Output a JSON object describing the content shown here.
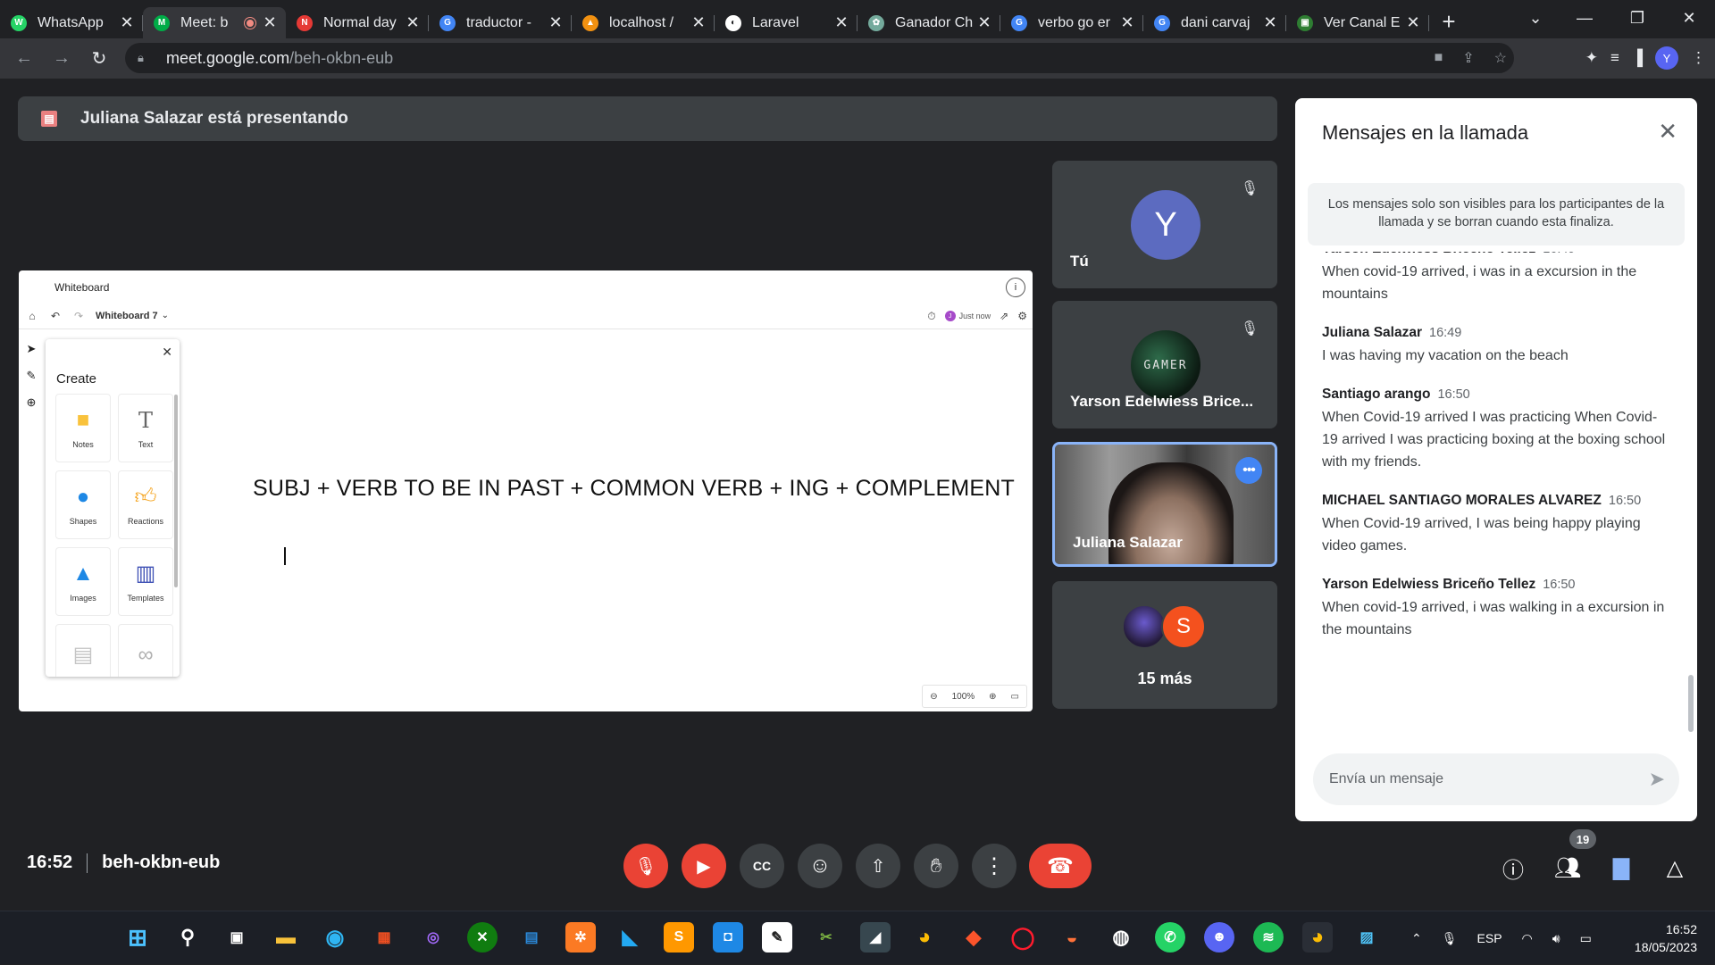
{
  "browser": {
    "tabs": [
      {
        "title": "WhatsApp",
        "color": "#25d366",
        "glyph": "W",
        "active": false
      },
      {
        "title": "Meet: b",
        "color": "#00ac47",
        "glyph": "M",
        "active": true,
        "recording": true
      },
      {
        "title": "Normal day",
        "color": "#e53935",
        "glyph": "N",
        "active": false
      },
      {
        "title": "traductor -",
        "color": "#4285f4",
        "glyph": "G",
        "active": false
      },
      {
        "title": "localhost /",
        "color": "#f29111",
        "glyph": "▲",
        "active": false
      },
      {
        "title": "Laravel",
        "color": "#ffffff",
        "glyph": "◐",
        "active": false
      },
      {
        "title": "Ganador Ch",
        "color": "#74aa9c",
        "glyph": "✿",
        "active": false
      },
      {
        "title": "verbo go er",
        "color": "#4285f4",
        "glyph": "G",
        "active": false
      },
      {
        "title": "dani carvaj",
        "color": "#4285f4",
        "glyph": "G",
        "active": false
      },
      {
        "title": "Ver Canal E",
        "color": "#2e7d32",
        "glyph": "▣",
        "active": false
      }
    ],
    "url_host": "meet.google.com",
    "url_path": "/beh-okbn-eub",
    "profile_initial": "Y"
  },
  "presenting": {
    "text": "Juliana Salazar está presentando"
  },
  "whiteboard": {
    "app_title": "Whiteboard",
    "board_name": "Whiteboard 7",
    "last_saved": "Just now",
    "create_title": "Create",
    "create_items": [
      {
        "label": "Notes",
        "icon": "sticky-note-icon"
      },
      {
        "label": "Text",
        "icon": "text-icon"
      },
      {
        "label": "Shapes",
        "icon": "shapes-icon"
      },
      {
        "label": "Reactions",
        "icon": "thumbs-up-icon"
      },
      {
        "label": "Images",
        "icon": "image-icon"
      },
      {
        "label": "Templates",
        "icon": "templates-icon"
      },
      {
        "label": "",
        "icon": "document-icon"
      },
      {
        "label": "",
        "icon": "link-icon"
      }
    ],
    "board_text": "SUBJ + VERB TO BE IN PAST + COMMON VERB + ING + COMPLEMENT",
    "zoom": "100%"
  },
  "participants": {
    "self": {
      "name": "Tú",
      "initial": "Y"
    },
    "tile2": {
      "name": "Yarson Edelwiess Brice...",
      "avatar_text": "GAMER"
    },
    "tile3": {
      "name": "Juliana Salazar"
    },
    "more": {
      "label": "15 más",
      "initial": "S"
    }
  },
  "chat": {
    "title": "Mensajes en la llamada",
    "notice": "Los mensajes solo son visibles para los participantes de la llamada y se borran cuando esta finaliza.",
    "messages": [
      {
        "sender": "Yarson Edelwiess Briceño Tellez",
        "time": "16:49",
        "text": "When covid-19 arrived, i was in a excursion in the mountains"
      },
      {
        "sender": "Juliana Salazar",
        "time": "16:49",
        "text": "I was having my vacation on the beach"
      },
      {
        "sender": "Santiago arango",
        "time": "16:50",
        "text": "When Covid-19 arrived I was practicing When Covid-19 arrived I was practicing boxing at the boxing school with my friends."
      },
      {
        "sender": "MICHAEL SANTIAGO MORALES ALVAREZ",
        "time": "16:50",
        "text": "When Covid-19 arrived, I was being happy playing video games."
      },
      {
        "sender": "Yarson Edelwiess Briceño Tellez",
        "time": "16:50",
        "text": "When covid-19 arrived, i was walking in a excursion in the mountains"
      }
    ],
    "input_placeholder": "Envía un mensaje"
  },
  "meeting": {
    "time": "16:52",
    "code": "beh-okbn-eub",
    "participant_count": "19"
  },
  "taskbar": {
    "language": "ESP",
    "clock_time": "16:52",
    "clock_date": "18/05/2023"
  }
}
